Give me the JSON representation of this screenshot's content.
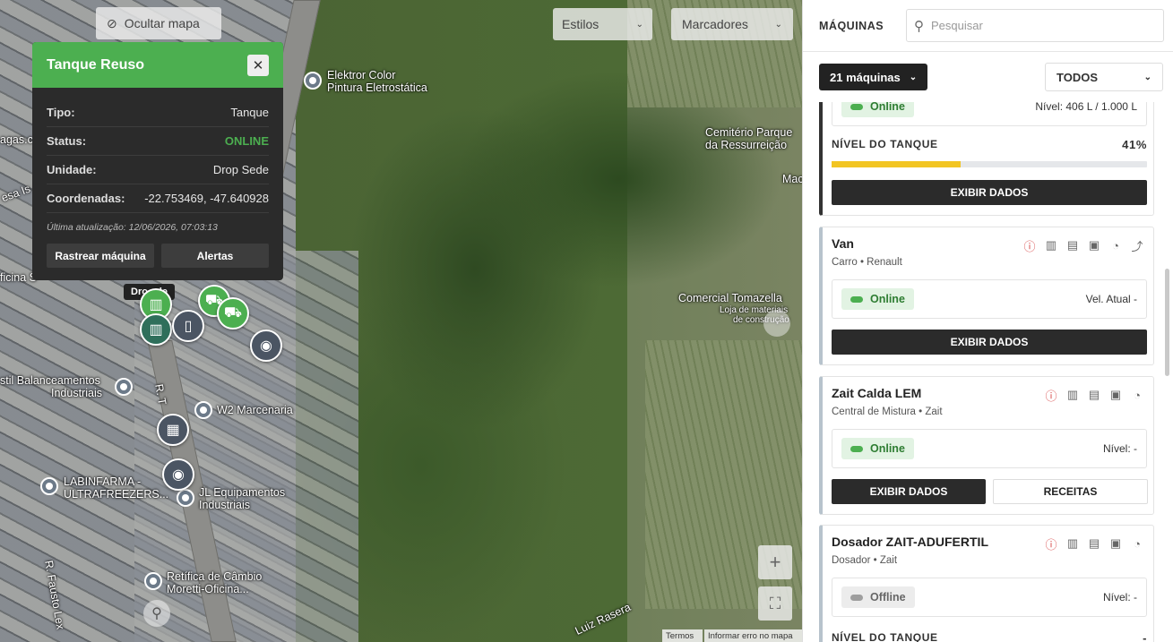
{
  "map": {
    "hide_map_label": "Ocultar mapa",
    "styles_label": "Estilos",
    "markers_label": "Marcadores",
    "labels": [
      "Elektror Color",
      "Pintura Eletrostática",
      "Cemitério Parque",
      "da Ressurreição",
      "Comercial Tomazella",
      "Loja de materiais",
      "de construção",
      "W2 Marcenaria",
      "stil Balanceamentos",
      "Industriais",
      "LABINFARMA -",
      "ULTRAFREEZERS...",
      "JL Equipamentos",
      "Industriais",
      "Retífica de Câmbio",
      "Moretti-Oficina...",
      "R. Fausto Lex",
      "R. T",
      "Luiz Rasera",
      "agas.c",
      "esa Is",
      "ficina S",
      "Mac",
      "Dro",
      "de"
    ],
    "attribution_terms": "Termos",
    "attribution_report": "Informar erro no mapa"
  },
  "popup": {
    "title": "Tanque Reuso",
    "rows": [
      {
        "key": "Tipo:",
        "value": "Tanque"
      },
      {
        "key": "Status:",
        "value": "ONLINE"
      },
      {
        "key": "Unidade:",
        "value": "Drop Sede"
      },
      {
        "key": "Coordenadas:",
        "value": "-22.753469, -47.640928"
      }
    ],
    "updated": "Última atualização: 12/06/2026, 07:03:13",
    "track_label": "Rastrear máquina",
    "alerts_label": "Alertas",
    "status_color": "#4caf50"
  },
  "panel": {
    "title": "MÁQUINAS",
    "search_placeholder": "Pesquisar",
    "count_label": "21 máquinas",
    "filter_value": "TODOS",
    "cards": [
      {
        "status": "Online",
        "reading": "Nível: 406 L / 1.000 L",
        "level_label": "NÍVEL DO TANQUE",
        "level_pct": "41%",
        "level_fraction": 0.41,
        "button": "EXIBIR DADOS"
      },
      {
        "name": "Van",
        "sub": "Carro • Renault",
        "status": "Online",
        "reading": "Vel. Atual  -",
        "button": "EXIBIR DADOS"
      },
      {
        "name": "Zait Calda LEM",
        "sub": "Central de Mistura • Zait",
        "status": "Online",
        "reading": "Nível: -",
        "button": "EXIBIR DADOS",
        "button2": "RECEITAS"
      },
      {
        "name": "Dosador ZAIT-ADUFERTIL",
        "sub": "Dosador • Zait",
        "status": "Offline",
        "reading": "Nível: -",
        "level_label": "NÍVEL DO TANQUE",
        "level_pct": "-"
      }
    ]
  }
}
